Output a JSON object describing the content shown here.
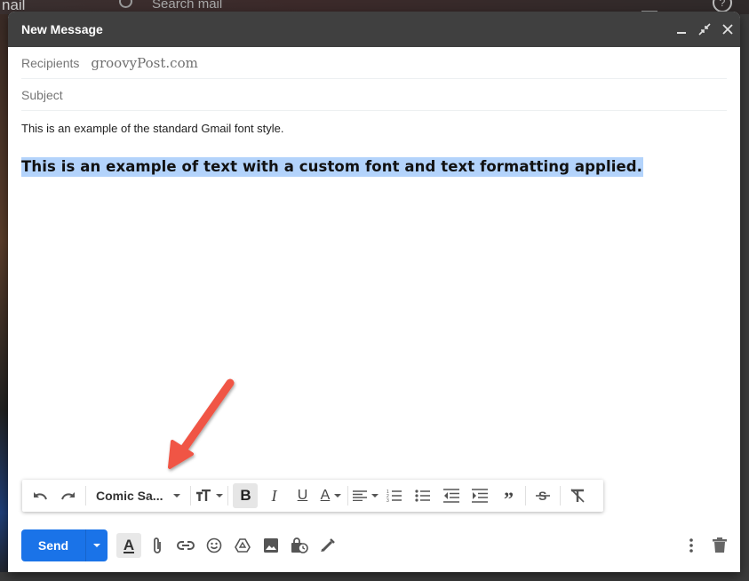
{
  "background": {
    "app_label": "nail",
    "search_placeholder": "Search mail",
    "icons": [
      "search-icon",
      "tune-icon",
      "help-icon"
    ]
  },
  "compose": {
    "title": "New Message",
    "window_controls": [
      "minimize-icon",
      "exit-fullscreen-icon",
      "close-icon"
    ],
    "recipients": {
      "label": "Recipients",
      "value": "groovyPost.com"
    },
    "subject": {
      "label": "Subject",
      "value": ""
    },
    "body": {
      "line1": "This is an example of the standard Gmail font style.",
      "line2": "This is an example of text with a custom font and text formatting applied.",
      "highlight_color": "#b3d3fb"
    }
  },
  "formatting_bar": {
    "font_name": "Comic Sa...",
    "buttons": [
      "undo-icon",
      "redo-icon",
      "font-select",
      "text-size-icon",
      "bold-icon",
      "italic-icon",
      "underline-icon",
      "text-color-icon",
      "align-icon",
      "numbered-list-icon",
      "bulleted-list-icon",
      "indent-less-icon",
      "indent-more-icon",
      "quote-icon",
      "strikethrough-icon",
      "remove-formatting-icon"
    ],
    "bold_active": true
  },
  "bottom_bar": {
    "send_label": "Send",
    "send_color": "#1a73e8",
    "icons": [
      "formatting-options-icon",
      "attach-icon",
      "link-icon",
      "emoji-icon",
      "drive-icon",
      "photo-icon",
      "confidential-mode-icon",
      "signature-icon",
      "more-options-icon",
      "discard-draft-icon"
    ]
  },
  "annotation": {
    "arrow_color": "#f05545"
  }
}
